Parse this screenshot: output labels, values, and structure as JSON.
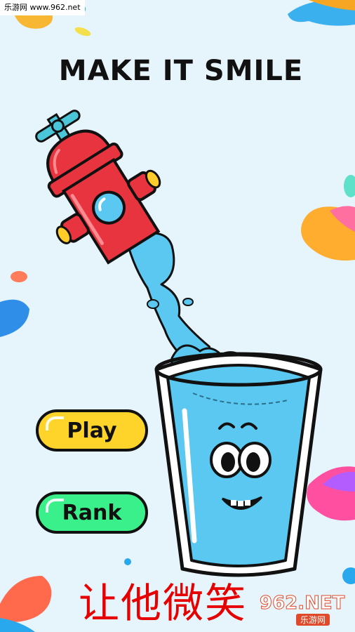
{
  "watermark_top": "乐游网 www.962.net",
  "title": "MAKE IT SMILE",
  "buttons": {
    "play_label": "Play",
    "rank_label": "Rank"
  },
  "caption": "让他微笑",
  "watermark_corner": {
    "logo": "962.NET",
    "sub": "乐游网"
  },
  "colors": {
    "background": "#e6f4fb",
    "play_button": "#ffd42a",
    "rank_button": "#3af08a",
    "hydrant": "#e8343f",
    "water": "#5ac8f0",
    "caption": "#e60000"
  },
  "icons": [
    "fire-hydrant-icon",
    "water-glass-character-icon"
  ]
}
